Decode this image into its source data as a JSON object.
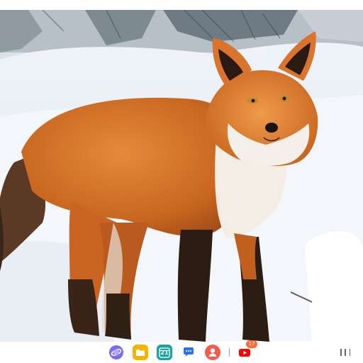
{
  "wallpaper": {
    "subject": "red-fox-in-snow"
  },
  "taskbar": {
    "apps": [
      {
        "icon": "internet-browser-icon",
        "color": "#7b6cf0"
      },
      {
        "icon": "my-files-icon",
        "color": "#f5b400"
      },
      {
        "icon": "calendar-icon",
        "color": "#1aa39a",
        "date": "21"
      },
      {
        "icon": "messages-icon",
        "color": "#2a73e8"
      },
      {
        "icon": "contacts-icon",
        "color": "#f25a4a"
      },
      {
        "icon": "youtube-icon",
        "color": "#ff0000",
        "badge": "17"
      }
    ],
    "recents_icon": "recent-apps-icon"
  }
}
